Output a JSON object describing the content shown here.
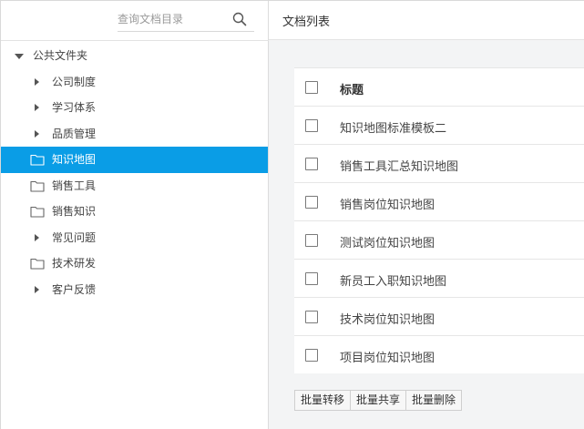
{
  "sidebar": {
    "search_placeholder": "查询文档目录",
    "tree": [
      {
        "label": "公共文件夹",
        "kind": "root",
        "icon": "caret-down-icon"
      },
      {
        "label": "公司制度",
        "kind": "child",
        "icon": "caret-right-icon"
      },
      {
        "label": "学习体系",
        "kind": "child",
        "icon": "caret-right-icon"
      },
      {
        "label": "品质管理",
        "kind": "child",
        "icon": "caret-right-icon"
      },
      {
        "label": "知识地图",
        "kind": "child",
        "icon": "folder-icon",
        "selected": true
      },
      {
        "label": "销售工具",
        "kind": "child",
        "icon": "folder-icon"
      },
      {
        "label": "销售知识",
        "kind": "child",
        "icon": "folder-icon"
      },
      {
        "label": "常见问题",
        "kind": "child",
        "icon": "caret-right-icon"
      },
      {
        "label": "技术研发",
        "kind": "child",
        "icon": "folder-icon"
      },
      {
        "label": "客户反馈",
        "kind": "child",
        "icon": "caret-right-icon"
      }
    ]
  },
  "main": {
    "title": "文档列表",
    "table": {
      "header": "标题",
      "rows": [
        "知识地图标准模板二",
        "销售工具汇总知识地图",
        "销售岗位知识地图",
        "测试岗位知识地图",
        "新员工入职知识地图",
        "技术岗位知识地图",
        "项目岗位知识地图"
      ]
    },
    "actions": {
      "move": "批量转移",
      "share": "批量共享",
      "delete": "批量删除"
    }
  },
  "colors": {
    "accent": "#0a9de6",
    "border": "#dcdcdc",
    "main_bg": "#f3f4f5"
  }
}
